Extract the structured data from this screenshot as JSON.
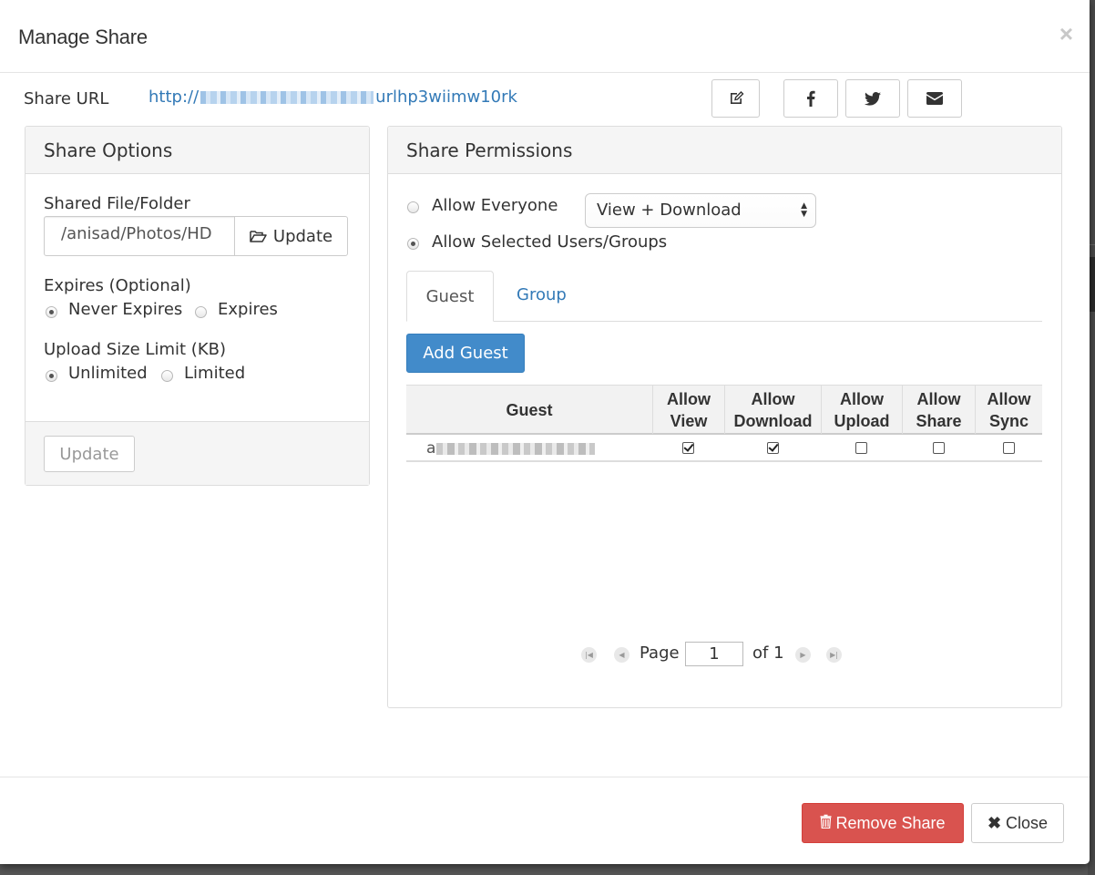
{
  "modal": {
    "title": "Manage Share",
    "close_glyph": "×"
  },
  "share_url": {
    "label": "Share URL",
    "prefix": "http://",
    "suffix": "urlhp3wiimw10rk"
  },
  "toolbar": {
    "icons": [
      "edit-icon",
      "facebook-icon",
      "twitter-icon",
      "envelope-icon"
    ]
  },
  "share_options": {
    "heading": "Share Options",
    "file_label": "Shared File/Folder",
    "file_path": "/anisad/Photos/HD",
    "update_path_label": "Update",
    "expires_label": "Expires (Optional)",
    "expires_options": [
      {
        "label": "Never Expires",
        "checked": true
      },
      {
        "label": "Expires",
        "checked": false
      }
    ],
    "upload_limit_label": "Upload Size Limit (KB)",
    "upload_options": [
      {
        "label": "Unlimited",
        "checked": true
      },
      {
        "label": "Limited",
        "checked": false
      }
    ],
    "footer_update_label": "Update"
  },
  "share_permissions": {
    "heading": "Share Permissions",
    "allow_everyone_label": "Allow Everyone",
    "allow_everyone_checked": false,
    "allow_selected_label": "Allow Selected Users/Groups",
    "allow_selected_checked": true,
    "permission_select": "View + Download",
    "tabs": [
      {
        "label": "Guest",
        "active": true
      },
      {
        "label": "Group",
        "active": false
      }
    ],
    "add_guest_label": "Add Guest",
    "grid": {
      "columns": [
        "Guest",
        "Allow\nView",
        "Allow\nDownload",
        "Allow\nUpload",
        "Allow\nShare",
        "Allow\nSync"
      ],
      "col_view": [
        "Allow",
        "View"
      ],
      "col_download": [
        "Allow",
        "Download"
      ],
      "col_upload": [
        "Allow",
        "Upload"
      ],
      "col_share": [
        "Allow",
        "Share"
      ],
      "col_sync": [
        "Allow",
        "Sync"
      ],
      "rows": [
        {
          "guest_initial": "a",
          "view": true,
          "download": true,
          "upload": false,
          "share": false,
          "sync": false
        }
      ]
    },
    "pager": {
      "page_label": "Page",
      "current_page": "1",
      "of_label": "of 1"
    }
  },
  "footer": {
    "remove_share_label": "Remove Share",
    "close_label": "Close"
  },
  "colors": {
    "link": "#337ab7",
    "primary": "#428bca",
    "danger": "#d9534f"
  }
}
